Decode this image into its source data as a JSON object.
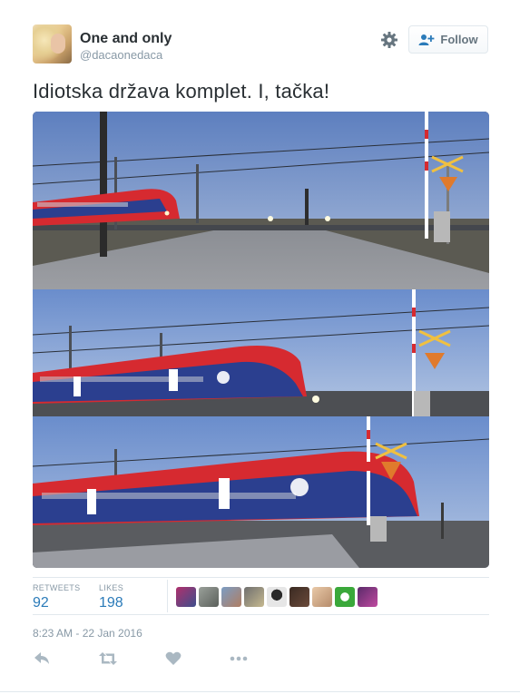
{
  "user": {
    "display_name": "One and only",
    "handle": "@dacaonedaca"
  },
  "header": {
    "follow_label": "Follow"
  },
  "tweet": {
    "text": "Idiotska država komplet. I, tačka!",
    "timestamp": "8:23 AM - 22 Jan 2016"
  },
  "stats": {
    "retweets_label": "RETWEETS",
    "retweets_count": "92",
    "likes_label": "LIKES",
    "likes_count": "198"
  },
  "colors": {
    "link_blue": "#2b7bb9",
    "muted_gray": "#8899a6",
    "text_dark": "#292f33",
    "train_red": "#d62a30",
    "train_blue": "#2b3f8f",
    "sky": "#6f8fc8"
  },
  "icons": {
    "settings": "gear-icon",
    "follow": "person-plus-icon",
    "reply": "reply-icon",
    "retweet": "retweet-icon",
    "like": "heart-icon",
    "more": "more-dots-icon"
  }
}
